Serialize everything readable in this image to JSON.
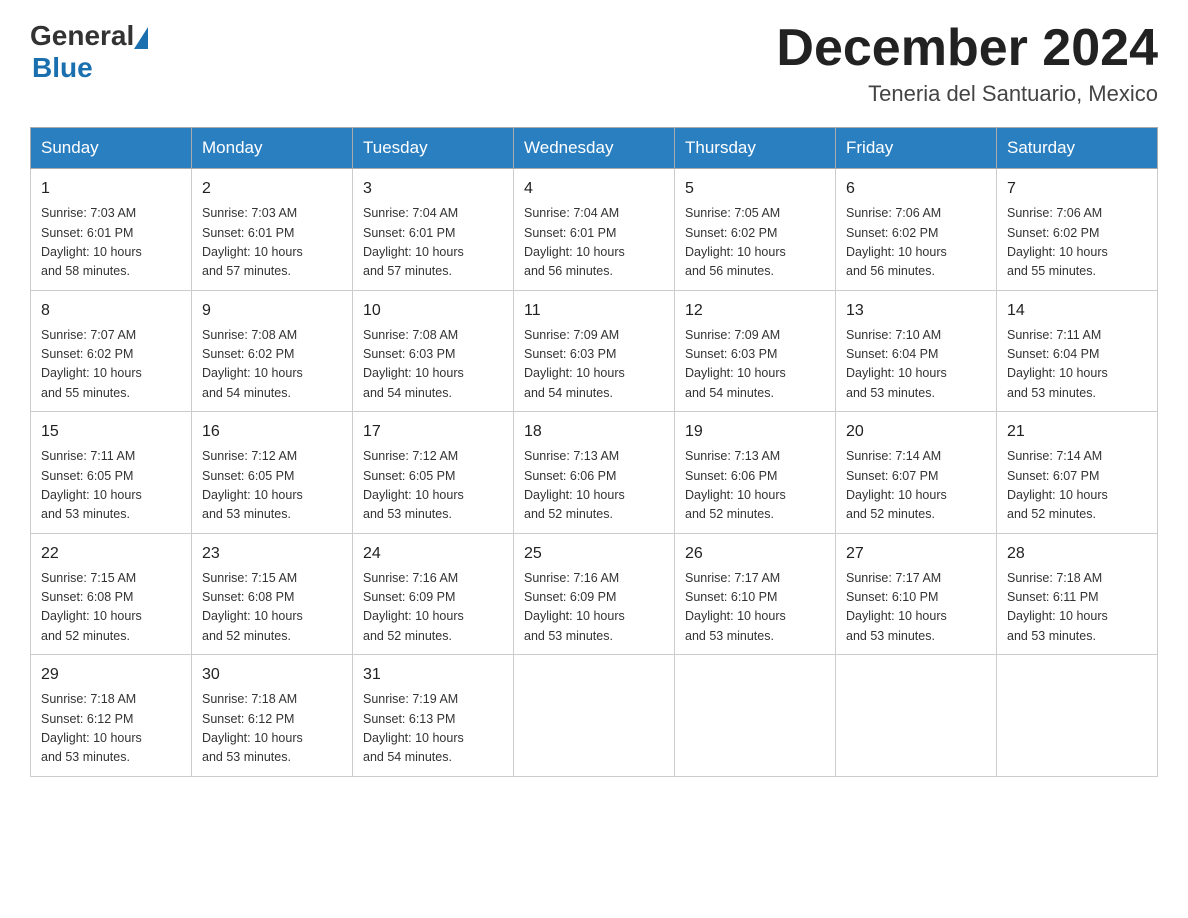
{
  "header": {
    "logo_general": "General",
    "logo_blue": "Blue",
    "month_title": "December 2024",
    "location": "Teneria del Santuario, Mexico"
  },
  "weekdays": [
    "Sunday",
    "Monday",
    "Tuesday",
    "Wednesday",
    "Thursday",
    "Friday",
    "Saturday"
  ],
  "weeks": [
    [
      {
        "day": "1",
        "info": "Sunrise: 7:03 AM\nSunset: 6:01 PM\nDaylight: 10 hours\nand 58 minutes."
      },
      {
        "day": "2",
        "info": "Sunrise: 7:03 AM\nSunset: 6:01 PM\nDaylight: 10 hours\nand 57 minutes."
      },
      {
        "day": "3",
        "info": "Sunrise: 7:04 AM\nSunset: 6:01 PM\nDaylight: 10 hours\nand 57 minutes."
      },
      {
        "day": "4",
        "info": "Sunrise: 7:04 AM\nSunset: 6:01 PM\nDaylight: 10 hours\nand 56 minutes."
      },
      {
        "day": "5",
        "info": "Sunrise: 7:05 AM\nSunset: 6:02 PM\nDaylight: 10 hours\nand 56 minutes."
      },
      {
        "day": "6",
        "info": "Sunrise: 7:06 AM\nSunset: 6:02 PM\nDaylight: 10 hours\nand 56 minutes."
      },
      {
        "day": "7",
        "info": "Sunrise: 7:06 AM\nSunset: 6:02 PM\nDaylight: 10 hours\nand 55 minutes."
      }
    ],
    [
      {
        "day": "8",
        "info": "Sunrise: 7:07 AM\nSunset: 6:02 PM\nDaylight: 10 hours\nand 55 minutes."
      },
      {
        "day": "9",
        "info": "Sunrise: 7:08 AM\nSunset: 6:02 PM\nDaylight: 10 hours\nand 54 minutes."
      },
      {
        "day": "10",
        "info": "Sunrise: 7:08 AM\nSunset: 6:03 PM\nDaylight: 10 hours\nand 54 minutes."
      },
      {
        "day": "11",
        "info": "Sunrise: 7:09 AM\nSunset: 6:03 PM\nDaylight: 10 hours\nand 54 minutes."
      },
      {
        "day": "12",
        "info": "Sunrise: 7:09 AM\nSunset: 6:03 PM\nDaylight: 10 hours\nand 54 minutes."
      },
      {
        "day": "13",
        "info": "Sunrise: 7:10 AM\nSunset: 6:04 PM\nDaylight: 10 hours\nand 53 minutes."
      },
      {
        "day": "14",
        "info": "Sunrise: 7:11 AM\nSunset: 6:04 PM\nDaylight: 10 hours\nand 53 minutes."
      }
    ],
    [
      {
        "day": "15",
        "info": "Sunrise: 7:11 AM\nSunset: 6:05 PM\nDaylight: 10 hours\nand 53 minutes."
      },
      {
        "day": "16",
        "info": "Sunrise: 7:12 AM\nSunset: 6:05 PM\nDaylight: 10 hours\nand 53 minutes."
      },
      {
        "day": "17",
        "info": "Sunrise: 7:12 AM\nSunset: 6:05 PM\nDaylight: 10 hours\nand 53 minutes."
      },
      {
        "day": "18",
        "info": "Sunrise: 7:13 AM\nSunset: 6:06 PM\nDaylight: 10 hours\nand 52 minutes."
      },
      {
        "day": "19",
        "info": "Sunrise: 7:13 AM\nSunset: 6:06 PM\nDaylight: 10 hours\nand 52 minutes."
      },
      {
        "day": "20",
        "info": "Sunrise: 7:14 AM\nSunset: 6:07 PM\nDaylight: 10 hours\nand 52 minutes."
      },
      {
        "day": "21",
        "info": "Sunrise: 7:14 AM\nSunset: 6:07 PM\nDaylight: 10 hours\nand 52 minutes."
      }
    ],
    [
      {
        "day": "22",
        "info": "Sunrise: 7:15 AM\nSunset: 6:08 PM\nDaylight: 10 hours\nand 52 minutes."
      },
      {
        "day": "23",
        "info": "Sunrise: 7:15 AM\nSunset: 6:08 PM\nDaylight: 10 hours\nand 52 minutes."
      },
      {
        "day": "24",
        "info": "Sunrise: 7:16 AM\nSunset: 6:09 PM\nDaylight: 10 hours\nand 52 minutes."
      },
      {
        "day": "25",
        "info": "Sunrise: 7:16 AM\nSunset: 6:09 PM\nDaylight: 10 hours\nand 53 minutes."
      },
      {
        "day": "26",
        "info": "Sunrise: 7:17 AM\nSunset: 6:10 PM\nDaylight: 10 hours\nand 53 minutes."
      },
      {
        "day": "27",
        "info": "Sunrise: 7:17 AM\nSunset: 6:10 PM\nDaylight: 10 hours\nand 53 minutes."
      },
      {
        "day": "28",
        "info": "Sunrise: 7:18 AM\nSunset: 6:11 PM\nDaylight: 10 hours\nand 53 minutes."
      }
    ],
    [
      {
        "day": "29",
        "info": "Sunrise: 7:18 AM\nSunset: 6:12 PM\nDaylight: 10 hours\nand 53 minutes."
      },
      {
        "day": "30",
        "info": "Sunrise: 7:18 AM\nSunset: 6:12 PM\nDaylight: 10 hours\nand 53 minutes."
      },
      {
        "day": "31",
        "info": "Sunrise: 7:19 AM\nSunset: 6:13 PM\nDaylight: 10 hours\nand 54 minutes."
      },
      {
        "day": "",
        "info": ""
      },
      {
        "day": "",
        "info": ""
      },
      {
        "day": "",
        "info": ""
      },
      {
        "day": "",
        "info": ""
      }
    ]
  ]
}
